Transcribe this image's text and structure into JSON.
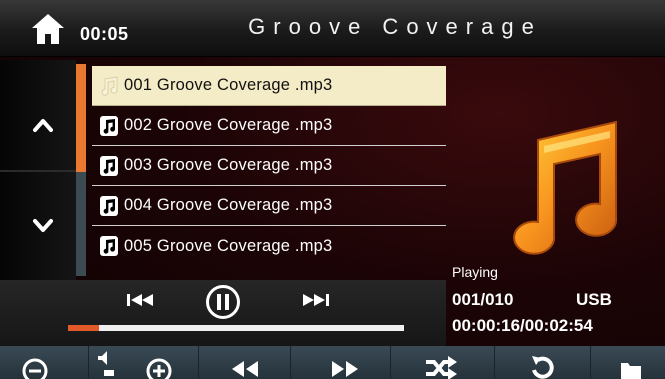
{
  "header": {
    "clock": "00:05",
    "title": "Groove Coverage"
  },
  "playlist": {
    "tracks": [
      {
        "name": "001 Groove Coverage .mp3",
        "selected": true
      },
      {
        "name": "002 Groove Coverage .mp3",
        "selected": false
      },
      {
        "name": "003 Groove Coverage .mp3",
        "selected": false
      },
      {
        "name": "004 Groove Coverage .mp3",
        "selected": false
      },
      {
        "name": "005 Groove Coverage .mp3",
        "selected": false
      }
    ]
  },
  "player": {
    "status": "Playing",
    "counter": "001/010",
    "source": "USB",
    "time": "00:00:16/00:02:54",
    "progress_fraction": 0.092
  },
  "colors": {
    "accent": "#e8792e",
    "progress": "#e25a2a",
    "selected_row": "#f4ecc6"
  },
  "icons": {
    "home": "home-icon",
    "up": "chevron-up-icon",
    "down": "chevron-down-icon",
    "prev": "skip-previous-icon",
    "pause": "pause-icon",
    "next": "skip-next-icon",
    "volume_down": "minus-circle-icon",
    "volume": "speaker-icon",
    "volume_up": "plus-circle-icon",
    "rewind": "rewind-icon",
    "fast_forward": "fast-forward-icon",
    "shuffle": "shuffle-icon",
    "repeat": "repeat-icon",
    "folder": "folder-icon"
  }
}
